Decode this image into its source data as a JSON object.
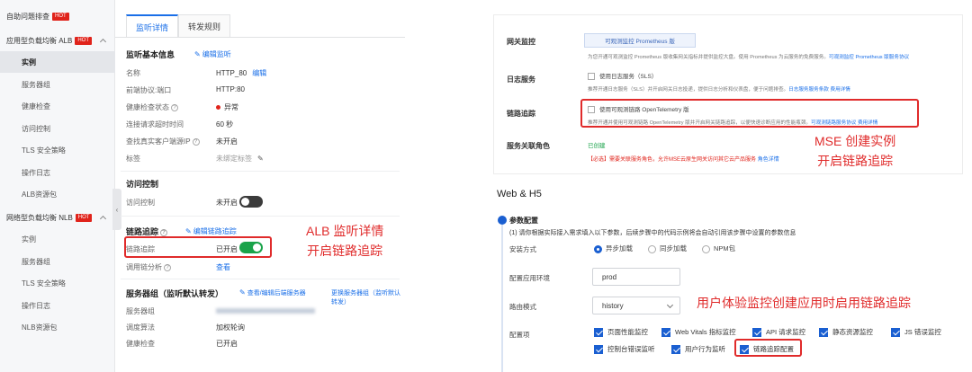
{
  "alb": {
    "sidebar": {
      "items": [
        {
          "label": "自助问题排查",
          "hot": "HOT",
          "kind": "group"
        },
        {
          "label": "应用型负载均衡 ALB",
          "hot": "HOT",
          "kind": "group"
        },
        {
          "label": "实例",
          "kind": "child",
          "active": true
        },
        {
          "label": "服务器组",
          "kind": "child"
        },
        {
          "label": "健康检查",
          "kind": "child"
        },
        {
          "label": "访问控制",
          "kind": "child"
        },
        {
          "label": "TLS 安全策略",
          "kind": "child"
        },
        {
          "label": "操作日志",
          "kind": "child"
        },
        {
          "label": "ALB资源包",
          "kind": "child"
        },
        {
          "label": "网络型负载均衡 NLB",
          "hot": "HOT",
          "kind": "group"
        },
        {
          "label": "实例",
          "kind": "child"
        },
        {
          "label": "服务器组",
          "kind": "child"
        },
        {
          "label": "TLS 安全策略",
          "kind": "child"
        },
        {
          "label": "操作日志",
          "kind": "child"
        },
        {
          "label": "NLB资源包",
          "kind": "child"
        }
      ],
      "collapse_glyph": "‹"
    },
    "tabs": [
      {
        "label": "监听详情",
        "active": true
      },
      {
        "label": "转发规则",
        "active": false
      }
    ],
    "basic": {
      "title": "监听基本信息",
      "edit_link": "编辑监听",
      "rows": [
        {
          "label": "名称",
          "value": "HTTP_80",
          "link": "编辑"
        },
        {
          "label": "前端协议:端口",
          "value": "HTTP:80"
        },
        {
          "label": "健康检查状态",
          "value": "异常"
        },
        {
          "label": "连接请求超时时间",
          "value": "60 秒"
        },
        {
          "label": "查找真实客户端源IP",
          "value": "未开启"
        },
        {
          "label": "标签",
          "value": "未绑定标签"
        }
      ]
    },
    "access": {
      "title": "访问控制",
      "label": "访问控制",
      "value": "未开启"
    },
    "tracing": {
      "title": "链路追踪",
      "edit_link": "编辑链路追踪",
      "label": "链路追踪",
      "value": "已开启",
      "sub_label": "调用链分析",
      "sub_link": "查看"
    },
    "servers": {
      "title": "服务器组（监听默认转发）",
      "link_view": "查看/编辑后端服务器",
      "link_change": "更换服务器组（监听默认转发）",
      "rows": [
        {
          "label": "服务器组"
        },
        {
          "label": "调度算法",
          "value": "加权轮询"
        },
        {
          "label": "健康检查",
          "value": "已开启"
        }
      ]
    },
    "annotation": {
      "line1": "ALB 监听详情",
      "line2": "开启链路追踪"
    }
  },
  "mse": {
    "rows": [
      {
        "label": "网关监控",
        "button": "可观测监控 Prometheus 版",
        "desc": "为您开通可观测监控 Prometheus 版收集网关指标并提供监控大盘。使用 Prometheus 为云服务的免费服务。",
        "desc_link": "可观测监控 Prometheus 版服务协议"
      },
      {
        "label": "日志服务",
        "option": "使用日志服务（SLS）",
        "desc": "推荐开通日志服务（SLS）并开启网关日志投递，提供日志分析和仪表盘，便于问题排查。",
        "desc_link": "日志服务服务条款",
        "desc_link2": "费用详情"
      },
      {
        "label": "链路追踪",
        "option": "使用可观测链路 OpenTelemetry 版",
        "desc": "推荐开通并使用可观测链路 OpenTelemetry 版并开启网关链路追踪，以便快速诊断应用的性能瓶颈。",
        "desc_link": "可观测链路服务协议",
        "desc_link2": "费用详情"
      },
      {
        "label": "服务关联角色",
        "status": "已创建",
        "required": "【必选】需要关联服务角色，允许MSE云原生网关访问其它云产品服务",
        "required_link": "角色详情"
      }
    ],
    "annotation": {
      "line1": "MSE 创建实例",
      "line2": "开启链路追踪"
    }
  },
  "web": {
    "title": "Web & H5",
    "param_title": "参数配置",
    "param_desc": "(1) 请你根据实际接入需求填入以下参数，后续步骤中的代码示例将会自动引用该步骤中设置的参数信息",
    "install": {
      "label": "安装方式",
      "options": [
        {
          "label": "异步加载",
          "selected": true
        },
        {
          "label": "同步加载",
          "selected": false
        },
        {
          "label": "NPM包",
          "selected": false
        }
      ]
    },
    "env": {
      "label": "配置应用环境",
      "value": "prod"
    },
    "route": {
      "label": "路由模式",
      "value": "history"
    },
    "config": {
      "label": "配置项",
      "items": [
        {
          "label": "页面性能监控",
          "checked": true
        },
        {
          "label": "Web Vitals 指标监控",
          "checked": true
        },
        {
          "label": "API 请求监控",
          "checked": true
        },
        {
          "label": "静态资源监控",
          "checked": true
        },
        {
          "label": "JS 错误监控",
          "checked": true
        },
        {
          "label": "控制台错误监听",
          "checked": true
        },
        {
          "label": "用户行为监听",
          "checked": true
        },
        {
          "label": "链路追踪配置",
          "checked": true
        }
      ]
    },
    "annotation": "用户体验监控创建应用时启用链路追踪"
  },
  "colors": {
    "accent": "#1a6fe8",
    "hot": "#e0231b",
    "highlight": "#e02b2b",
    "toggle_on": "#1aa34a",
    "toggle_off": "#3b3b3b"
  }
}
